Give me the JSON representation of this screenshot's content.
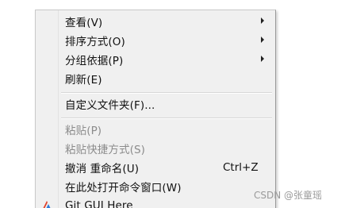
{
  "context_menu": {
    "items": [
      {
        "label": "查看(V)",
        "submenu": true,
        "disabled": false
      },
      {
        "label": "排序方式(O)",
        "submenu": true,
        "disabled": false
      },
      {
        "label": "分组依据(P)",
        "submenu": true,
        "disabled": false
      },
      {
        "label": "刷新(E)",
        "submenu": false,
        "disabled": false
      },
      {
        "label": "自定义文件夹(F)...",
        "submenu": false,
        "disabled": false
      },
      {
        "label": "粘贴(P)",
        "submenu": false,
        "disabled": true
      },
      {
        "label": "粘贴快捷方式(S)",
        "submenu": false,
        "disabled": true
      },
      {
        "label": "撤消 重命名(U)",
        "shortcut": "Ctrl+Z",
        "submenu": false,
        "disabled": false
      },
      {
        "label": "在此处打开命令窗口(W)",
        "submenu": false,
        "disabled": false
      },
      {
        "label": "Git GUI Here",
        "icon": "git-gui-icon",
        "submenu": false,
        "disabled": false
      }
    ]
  },
  "watermark": "CSDN @张童瑶",
  "colors": {
    "menu_background": "#f0f0f0",
    "disabled_text": "#8c8c8c",
    "text": "#111111",
    "git_icon_red": "#e0402a",
    "git_icon_blue": "#2f7bd8"
  }
}
